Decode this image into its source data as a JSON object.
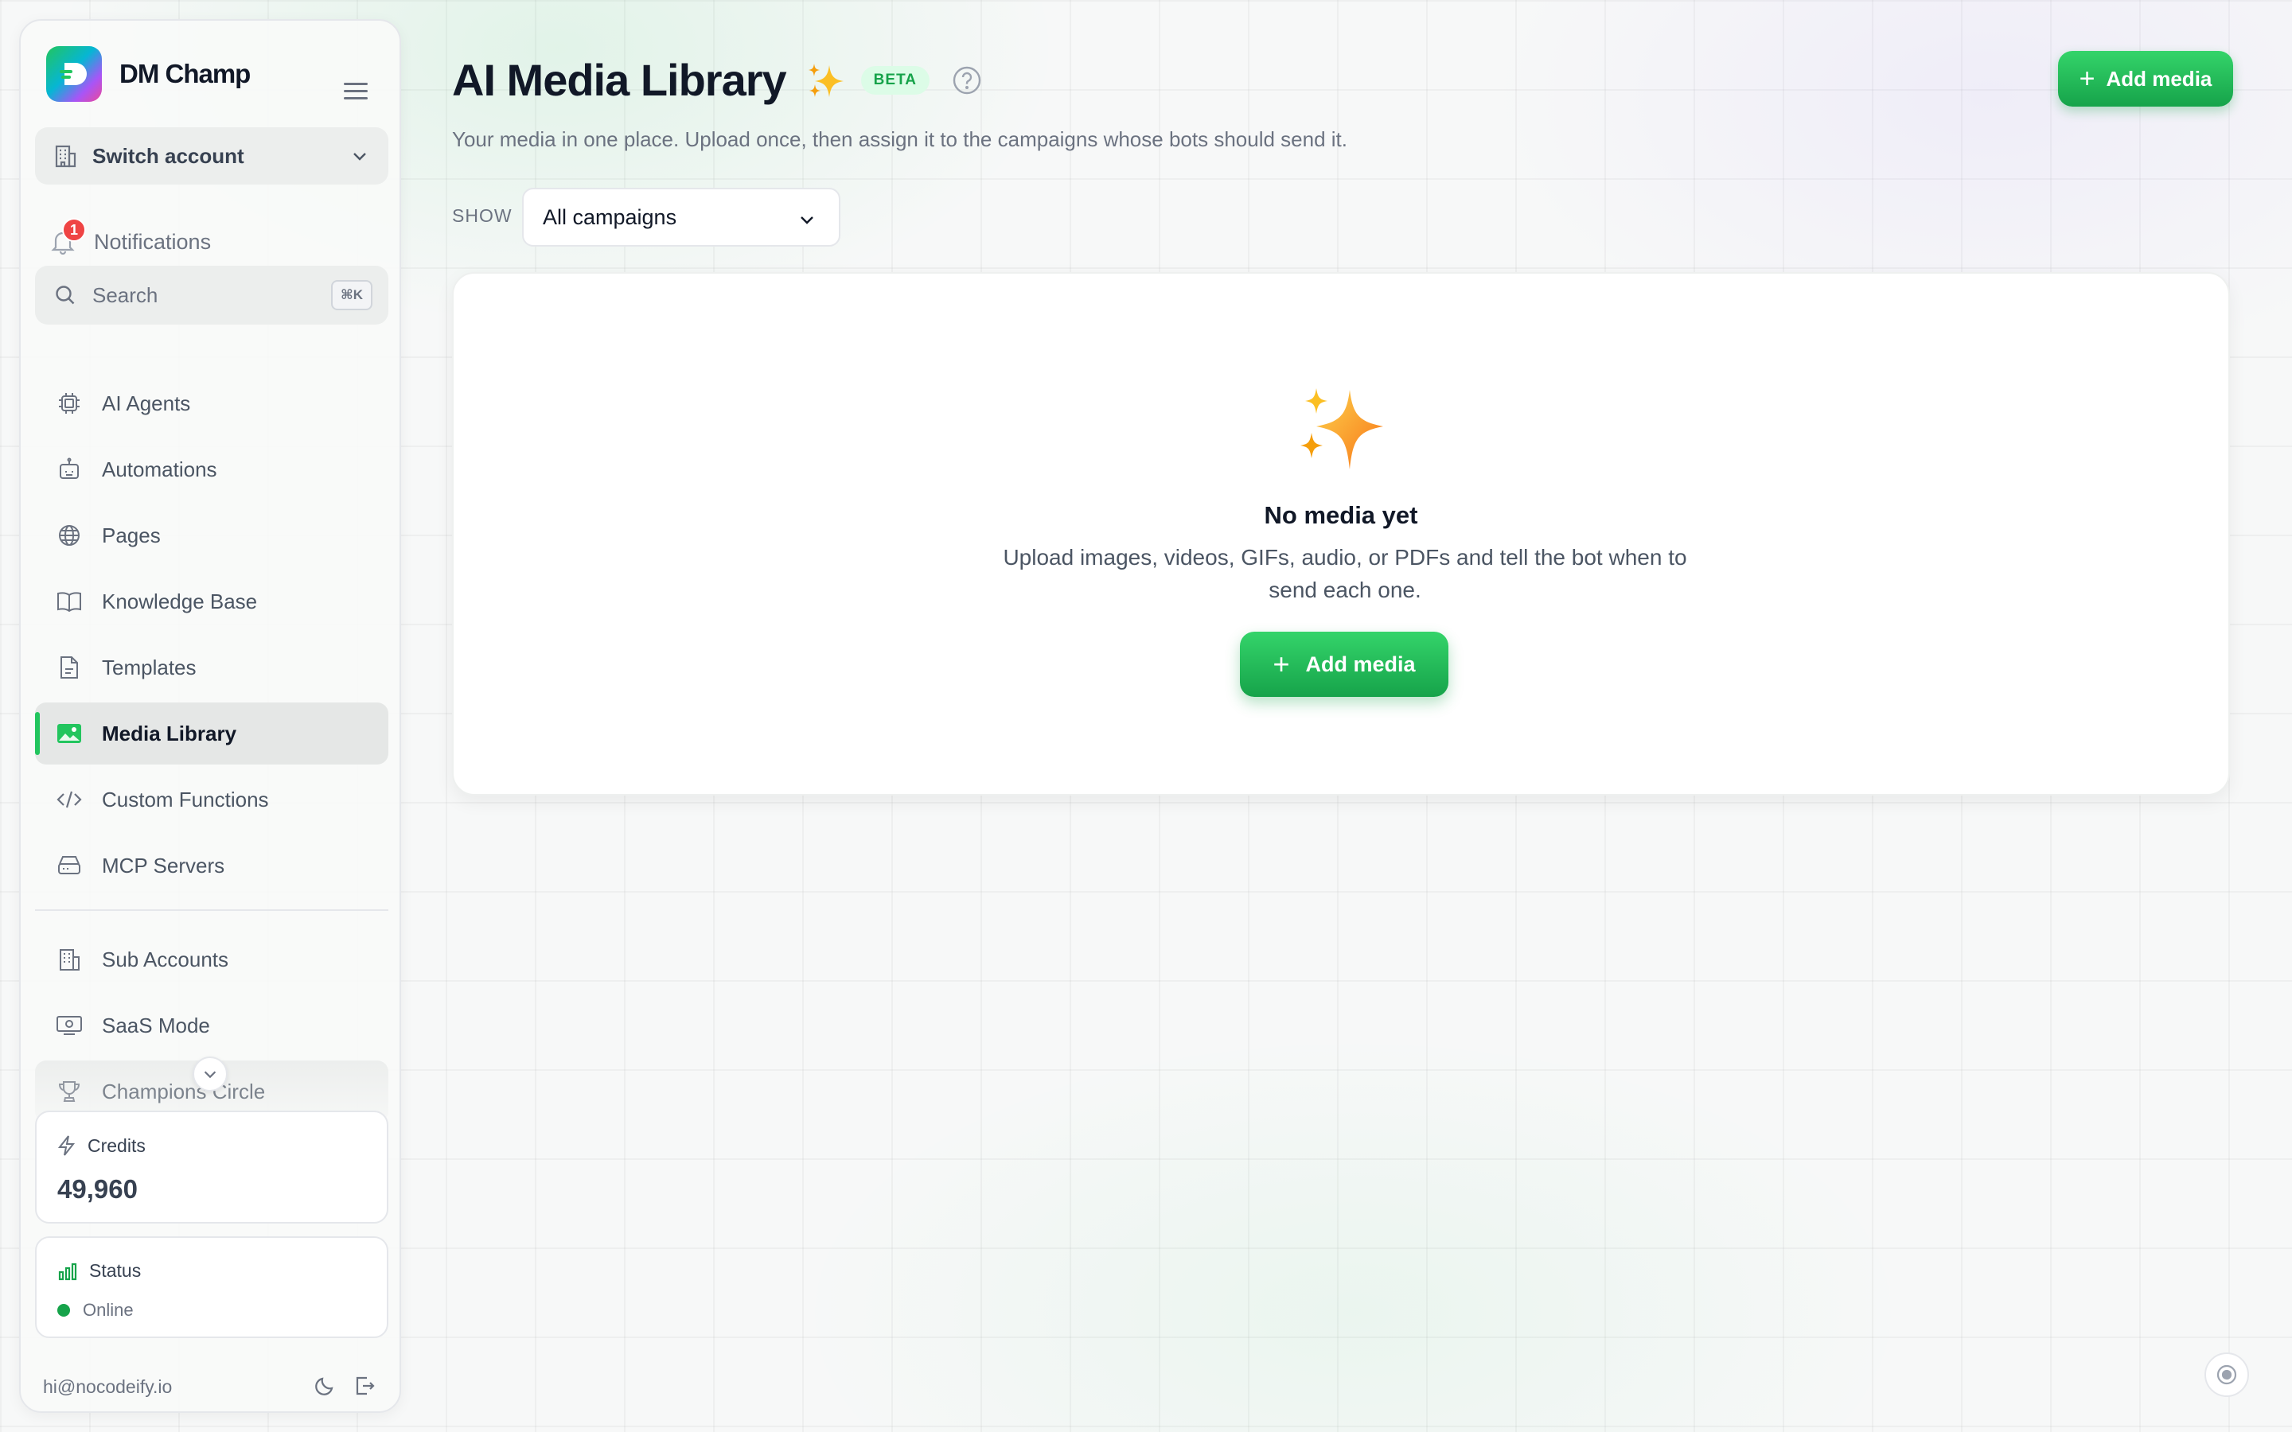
{
  "app": {
    "brand_name": "DM Champ"
  },
  "sidebar": {
    "switch_account_label": "Switch account",
    "notifications_label": "Notifications",
    "notifications_count": "1",
    "search_placeholder": "Search",
    "search_shortcut": "⌘K",
    "items": [
      {
        "label": "AI Agents",
        "icon": "cpu-icon"
      },
      {
        "label": "Automations",
        "icon": "robot-icon"
      },
      {
        "label": "Pages",
        "icon": "globe-icon"
      },
      {
        "label": "Knowledge Base",
        "icon": "book-icon"
      },
      {
        "label": "Templates",
        "icon": "document-icon"
      },
      {
        "label": "Media Library",
        "icon": "image-icon",
        "active": true
      },
      {
        "label": "Custom Functions",
        "icon": "code-icon"
      },
      {
        "label": "MCP Servers",
        "icon": "server-icon"
      }
    ],
    "secondary_items": [
      {
        "label": "Sub Accounts",
        "icon": "building-icon"
      },
      {
        "label": "SaaS Mode",
        "icon": "monitor-icon"
      },
      {
        "label": "Champions Circle",
        "icon": "trophy-icon"
      }
    ],
    "credits": {
      "label": "Credits",
      "value": "49,960"
    },
    "status": {
      "label": "Status",
      "value": "Online"
    },
    "footer_email": "hi@nocodeify.io"
  },
  "main": {
    "title": "AI Media Library",
    "badge": "BETA",
    "subtitle": "Your media in one place. Upload once, then assign it to the campaigns whose bots should send it.",
    "add_media_label": "Add media",
    "filter": {
      "label": "SHOW",
      "selected": "All campaigns"
    },
    "empty": {
      "title": "No media yet",
      "description": "Upload images, videos, GIFs, audio, or PDFs and tell the bot when to send each one.",
      "button_label": "Add media"
    }
  },
  "colors": {
    "accent": "#22c55e",
    "accent_dark": "#16a34a",
    "badge_bg": "#dcfce7",
    "notification": "#ef4444"
  }
}
